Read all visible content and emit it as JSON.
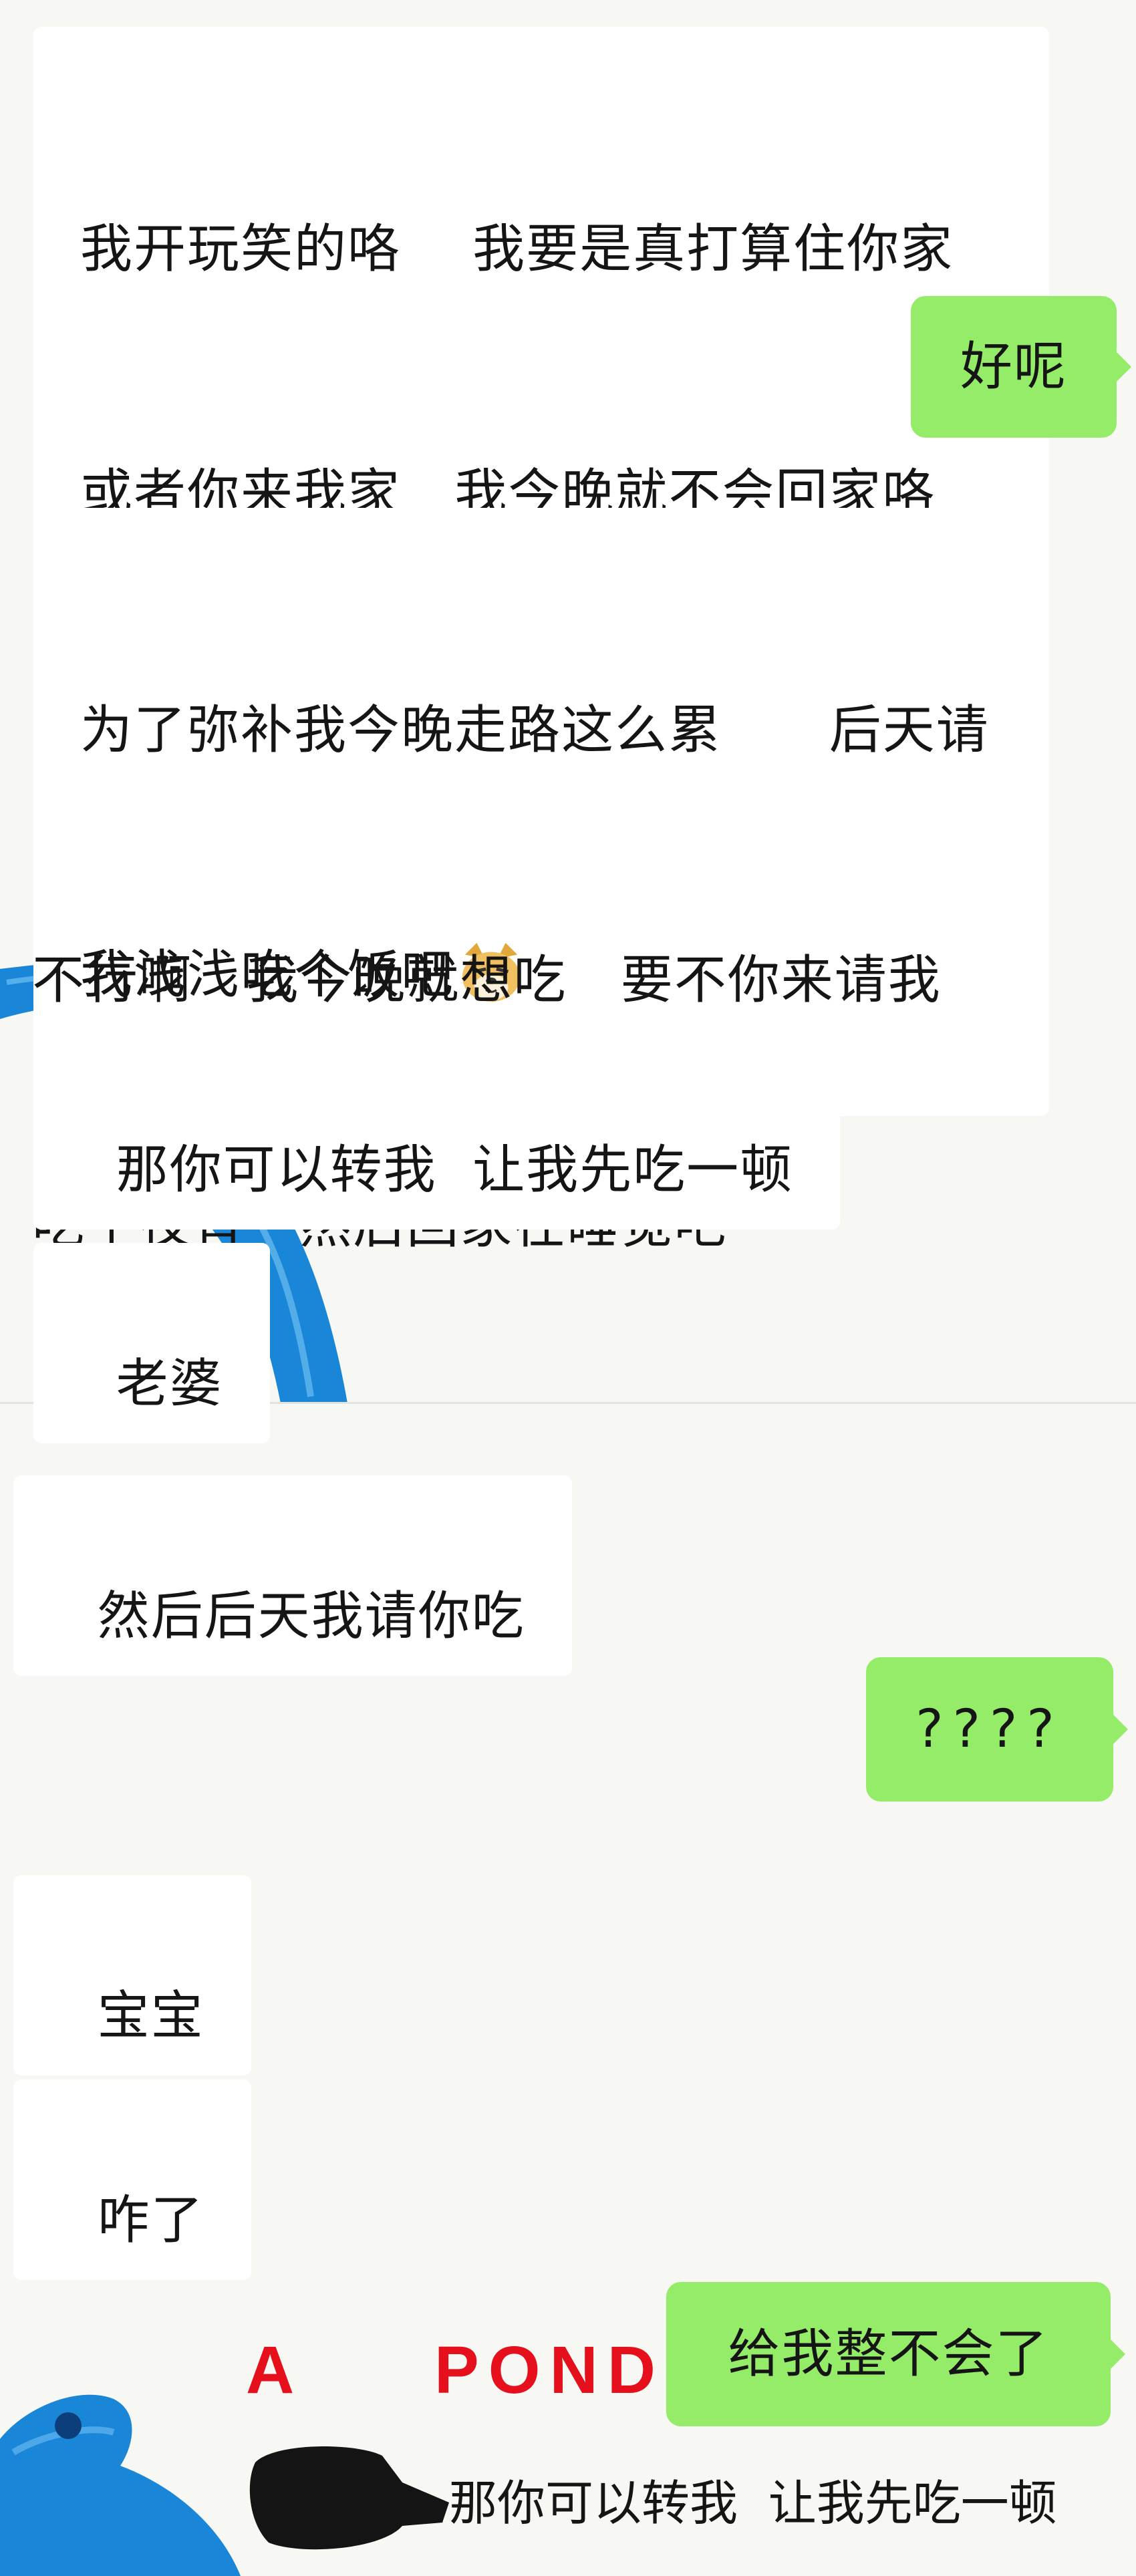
{
  "chat": {
    "messages": [
      {
        "side": "in",
        "lines": [
          "我开玩笑的咯    我要是真打算住你家",
          "或者你来我家   我今晚就不会回家咯"
        ]
      },
      {
        "side": "out",
        "text": "好呢"
      },
      {
        "side": "in",
        "lines": [
          "为了弥补我今晚走路这么累      后天请",
          "我浅浅吃个饭吧"
        ],
        "emoji": "doge-emoji"
      },
      {
        "side": "in",
        "lines": [
          "不行啊   我今晚就想吃   要不你来请我",
          "吃个夜宵   然后回家在睡觉吧"
        ]
      },
      {
        "side": "in",
        "text": "那你可以转我  让我先吃一顿"
      },
      {
        "side": "in",
        "text": "老婆"
      },
      {
        "side": "in",
        "text": "然后后天我请你吃"
      },
      {
        "side": "out",
        "text": "????"
      },
      {
        "side": "in",
        "text": "宝宝"
      },
      {
        "side": "in",
        "text": "咋了"
      },
      {
        "side": "out",
        "text": "给我整不会了"
      }
    ]
  },
  "meme": {
    "painted_letters_a": "A",
    "painted_letters_pond": "POND",
    "caption": "那你可以转我  让我先吃一顿",
    "colors": {
      "paint_blue": "#1a86d8",
      "paint_red": "#e5101b"
    }
  },
  "colors": {
    "incoming_bubble": "#ffffff",
    "outgoing_bubble": "#95ec69",
    "background": "#f7f7f3"
  }
}
